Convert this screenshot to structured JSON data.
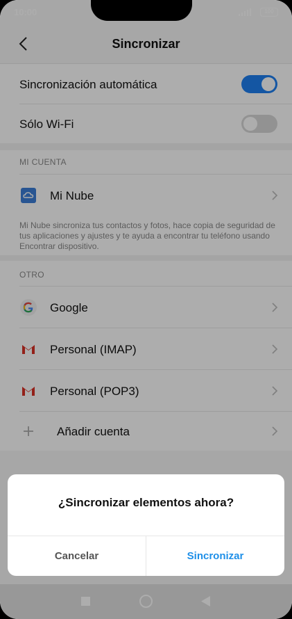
{
  "status_bar": {
    "time": "10:00",
    "battery": "100"
  },
  "header": {
    "title": "Sincronizar"
  },
  "settings": {
    "auto_sync": {
      "label": "Sincronización automática",
      "enabled": true
    },
    "wifi_only": {
      "label": "Sólo Wi-Fi",
      "enabled": false
    }
  },
  "mi_cuenta": {
    "section_label": "MI CUENTA",
    "mi_nube": {
      "label": "Mi Nube"
    },
    "note": "Mi Nube sincroniza tus contactos y fotos, hace copia de seguridad de tus aplicaciones y ajustes y te ayuda a encontrar tu teléfono usando Encontrar dispositivo."
  },
  "otro": {
    "section_label": "OTRO",
    "accounts": [
      {
        "label": "Google",
        "icon": "google-icon"
      },
      {
        "label": "Personal (IMAP)",
        "icon": "gmail-icon"
      },
      {
        "label": "Personal (POP3)",
        "icon": "gmail-icon"
      }
    ],
    "add_account": {
      "label": "Añadir cuenta",
      "icon": "plus-icon"
    }
  },
  "dialog": {
    "title": "¿Sincronizar elementos ahora?",
    "cancel_label": "Cancelar",
    "confirm_label": "Sincronizar"
  },
  "colors": {
    "accent": "#1e7ff0",
    "toggle_off": "#d8d8d8",
    "cancel_text": "#555555",
    "confirm_text": "#1e8fe8"
  }
}
